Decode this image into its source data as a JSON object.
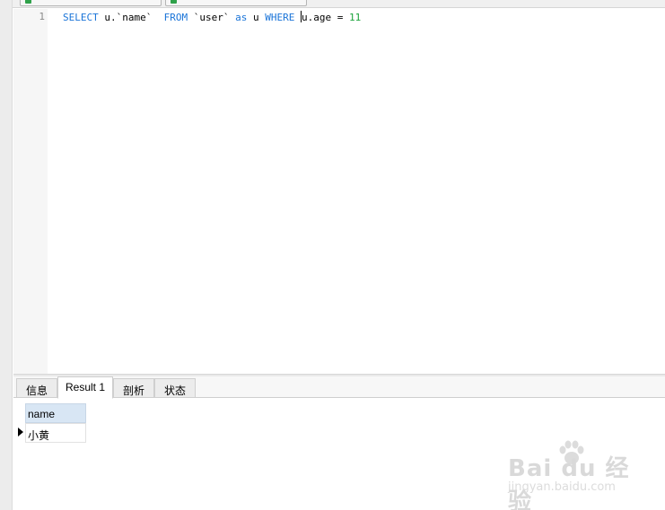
{
  "editor": {
    "line_number": "1",
    "sql": {
      "t1": "SELECT",
      "t2": " u.`name`  ",
      "t3": "FROM",
      "t4": " `user` ",
      "t5": "as",
      "t6": " u ",
      "t7": "WHERE",
      "t8": " ",
      "t9": "u.age = ",
      "t10": "11"
    }
  },
  "result_tabs": [
    {
      "label": "信息"
    },
    {
      "label": "Result 1"
    },
    {
      "label": "剖析"
    },
    {
      "label": "状态"
    }
  ],
  "result_grid": {
    "columns": [
      "name"
    ],
    "rows": [
      [
        "小黄"
      ]
    ]
  },
  "watermark": {
    "brand": "Bai du 经验",
    "url": "jingyan.baidu.com"
  },
  "colors": {
    "keyword": "#1a74d8",
    "number": "#1ba33b",
    "header_bg": "#d8e6f4"
  }
}
